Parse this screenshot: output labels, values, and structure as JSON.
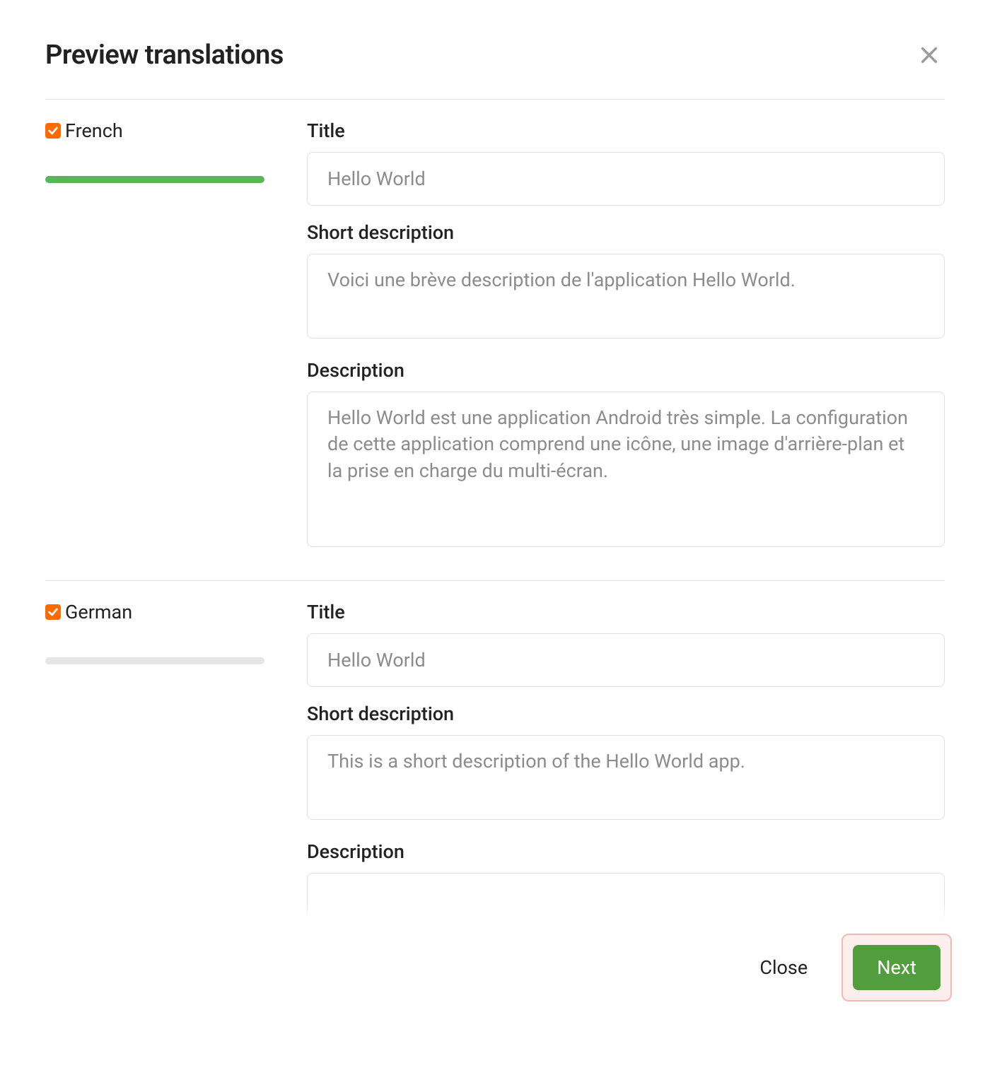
{
  "header": {
    "title": "Preview translations"
  },
  "labels": {
    "title": "Title",
    "short_desc": "Short description",
    "description": "Description"
  },
  "langs": [
    {
      "name": "French",
      "checked": true,
      "progress_complete": true,
      "title_value": "Hello World",
      "short_desc_value": "Voici une brève description de l'application Hello World.",
      "desc_value": "Hello World est une application Android très simple. La configuration de cette application comprend une icône, une image d'arrière-plan et la prise en charge du multi-écran."
    },
    {
      "name": "German",
      "checked": true,
      "progress_complete": false,
      "title_value": "Hello World",
      "short_desc_value": "This is a short description of the Hello World app.",
      "desc_value": ""
    }
  ],
  "footer": {
    "close": "Close",
    "next": "Next"
  }
}
